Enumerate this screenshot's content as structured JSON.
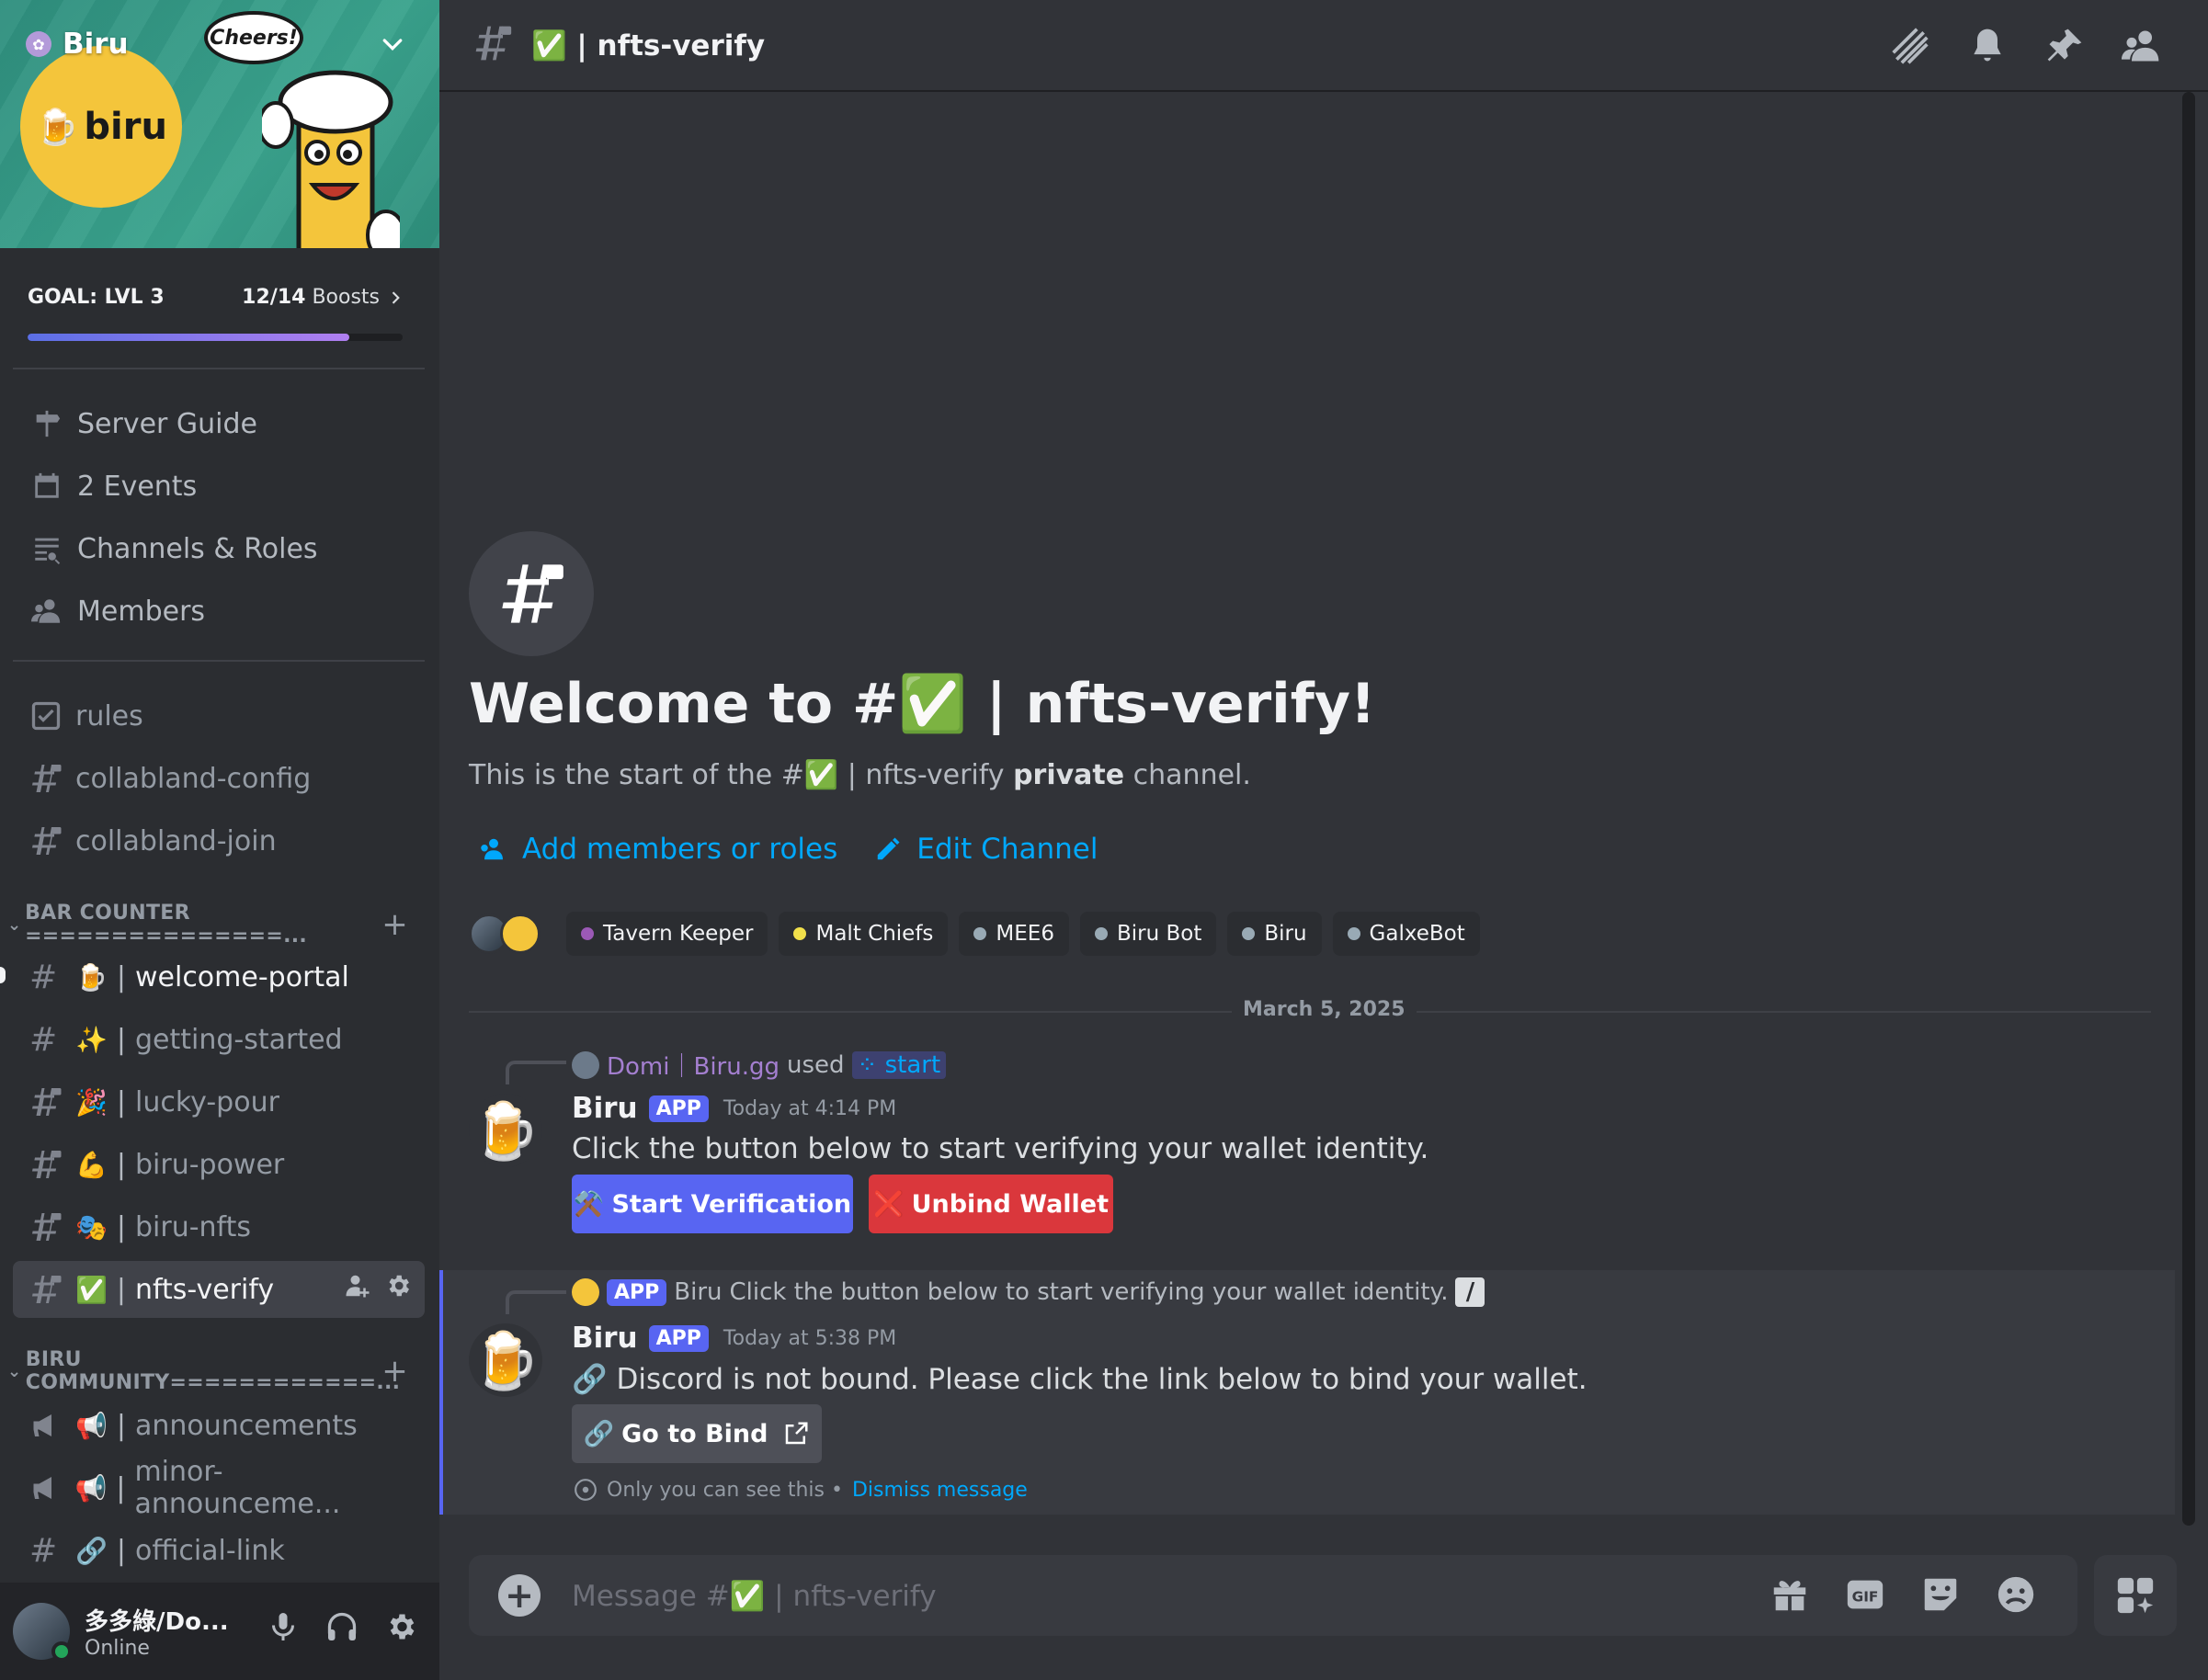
{
  "server": {
    "name": "Biru",
    "logo_text": "biru",
    "banner_bubble": "Cheers!",
    "boost_goal": "GOAL: LVL 3",
    "boost_count": "12/14",
    "boost_label": "Boosts",
    "boost_progress_fraction": 0.857
  },
  "nav": {
    "items": [
      {
        "label": "Server Guide",
        "icon": "signpost-icon"
      },
      {
        "label": "2 Events",
        "icon": "calendar-icon"
      },
      {
        "label": "Channels & Roles",
        "icon": "channels-browse-icon"
      },
      {
        "label": "Members",
        "icon": "members-icon"
      }
    ]
  },
  "channels_top": [
    {
      "name": "rules",
      "icon": "rules-checkbox-icon"
    },
    {
      "name": "collabland-config",
      "icon": "locked-hash-icon"
    },
    {
      "name": "collabland-join",
      "icon": "locked-hash-icon"
    }
  ],
  "categories": {
    "bar_counter": "BAR COUNTER ===============...",
    "community": "BIRU COMMUNITY============..."
  },
  "bar_counter_channels": [
    {
      "emoji": "🍺",
      "name": "welcome-portal",
      "state": "unread"
    },
    {
      "emoji": "✨",
      "name": "getting-started",
      "state": "normal"
    },
    {
      "emoji": "🎉",
      "name": "lucky-pour",
      "state": "normal"
    },
    {
      "emoji": "💪",
      "name": "biru-power",
      "state": "normal"
    },
    {
      "emoji": "🎭",
      "name": "biru-nfts",
      "state": "normal"
    },
    {
      "emoji": "✅",
      "name": "nfts-verify",
      "state": "active"
    }
  ],
  "community_channels": [
    {
      "emoji": "📢",
      "name": "announcements"
    },
    {
      "emoji": "📢",
      "name": "minor-announceme..."
    },
    {
      "emoji": "🔗",
      "name": "official-link"
    }
  ],
  "user": {
    "name": "多多綠/Do...",
    "status": "Online",
    "status_color": "#23a55a"
  },
  "header": {
    "emoji": "✅",
    "title": "| nfts-verify"
  },
  "welcome": {
    "title": "Welcome to #✅ | nfts-verify!",
    "sub_prefix": "This is the start of the #✅ | nfts-verify ",
    "sub_bold": "private",
    "sub_suffix": " channel.",
    "add_members": "Add members or roles",
    "edit_channel": "Edit Channel"
  },
  "roles": [
    {
      "name": "Tavern Keeper",
      "color": "#9b59b6"
    },
    {
      "name": "Malt Chiefs",
      "color": "#f1e04b"
    },
    {
      "name": "MEE6",
      "color": "#99aab5"
    },
    {
      "name": "Biru Bot",
      "color": "#99aab5"
    },
    {
      "name": "Biru",
      "color": "#99aab5"
    },
    {
      "name": "GalxeBot",
      "color": "#99aab5"
    }
  ],
  "date_divider": "March 5, 2025",
  "message1": {
    "reply_user": "Domi｜Biru.gg",
    "reply_used": "used",
    "reply_command": "start",
    "author": "Biru",
    "tag": "APP",
    "time": "Today at 4:14 PM",
    "body": "Click the button below to start verifying your wallet identity.",
    "btn_start": "Start Verification",
    "btn_start_emoji": "⚒️",
    "btn_unbind": "Unbind Wallet",
    "btn_unbind_emoji": "❌"
  },
  "message2": {
    "reply_tag": "APP",
    "reply_author": "Biru",
    "reply_text": "Click the button below to start verifying your wallet identity.",
    "author": "Biru",
    "tag": "APP",
    "time": "Today at 5:38 PM",
    "body_emoji": "🔗",
    "body": "Discord is not bound. Please click the link below to bind your wallet.",
    "btn_bind": "Go to Bind",
    "btn_bind_emoji": "🔗",
    "only_you": "Only you can see this •",
    "dismiss": "Dismiss message"
  },
  "composer": {
    "placeholder_prefix": "Message #",
    "placeholder_emoji": "✅",
    "placeholder_suffix": "| nfts-verify"
  },
  "colors": {
    "accent": "#5865f2",
    "danger": "#da373c",
    "link": "#00a8fc",
    "sidebar_bg": "#2b2d31",
    "main_bg": "#313338"
  }
}
